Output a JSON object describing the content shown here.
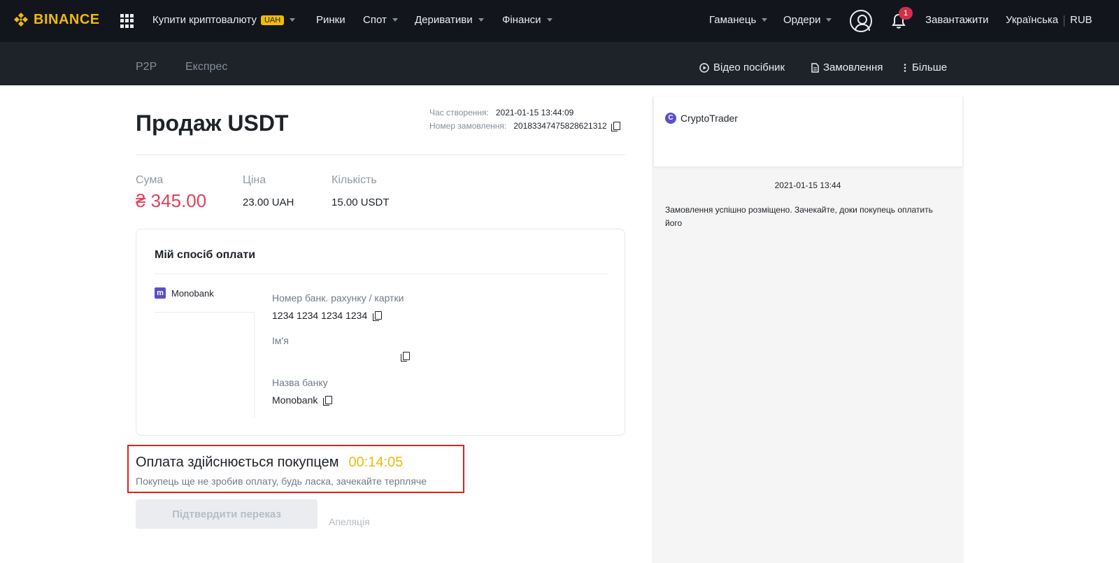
{
  "topnav": {
    "logo": "BINANCE",
    "items": [
      {
        "label": "Купити криптовалюту",
        "badge": "UAH"
      },
      {
        "label": "Ринки"
      },
      {
        "label": "Спот"
      },
      {
        "label": "Деривативи"
      },
      {
        "label": "Фінанси"
      }
    ],
    "right": {
      "wallet": "Гаманець",
      "orders": "Ордери",
      "notification_count": "1",
      "download": "Завантажити",
      "language": "Українська",
      "currency": "RUB"
    }
  },
  "subnav": {
    "tabs": [
      "P2P",
      "Експрес"
    ],
    "actions": {
      "video_guide": "Відео посібник",
      "orders": "Замовлення",
      "more": "Більше"
    }
  },
  "order": {
    "title": "Продаж USDT",
    "created_label": "Час створення:",
    "created_value": "2021-01-15 13:44:09",
    "number_label": "Номер замовлення:",
    "number_value": "20183347475828621312",
    "amount_label": "Сума",
    "amount_value": "₴ 345.00",
    "price_label": "Ціна",
    "price_value": "23.00 UAH",
    "qty_label": "Кількість",
    "qty_value": "15.00 USDT"
  },
  "payment": {
    "title": "Мій спосіб оплати",
    "method": "Monobank",
    "method_icon": "m",
    "account_label": "Номер банк. рахунку / картки",
    "account_value": "1234 1234 1234 1234",
    "name_label": "Ім'я",
    "name_value": "",
    "bank_label": "Назва банку",
    "bank_value": "Monobank"
  },
  "status": {
    "title": "Оплата здійснюється покупцем",
    "timer": "00:14:05",
    "subtitle": "Покупець ще не зробив оплату, будь ласка, зачекайте терпляче",
    "confirm_button": "Підтвердити переказ",
    "appeal": "Апеляція"
  },
  "chat": {
    "trader_initial": "C",
    "trader_name": "CryptoTrader",
    "time": "2021-01-15 13:44",
    "message": "Замовлення успішно розміщено. Зачекайте, доки покупець оплатить його"
  },
  "colors": {
    "brand": "#f0b90b",
    "amount": "#e0405b",
    "highlight": "#e02020"
  }
}
